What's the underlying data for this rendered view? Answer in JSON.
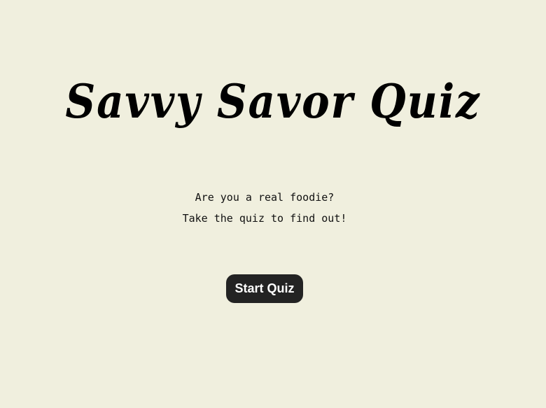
{
  "title": "Savvy Savor Quiz",
  "tagline": {
    "line1": "Are you a real foodie?",
    "line2": "Take the quiz to find out!"
  },
  "start_button": {
    "label": "Start Quiz"
  },
  "colors": {
    "background": "#f0efde",
    "text": "#000000",
    "button_bg": "#232323",
    "button_text": "#ffffff"
  }
}
